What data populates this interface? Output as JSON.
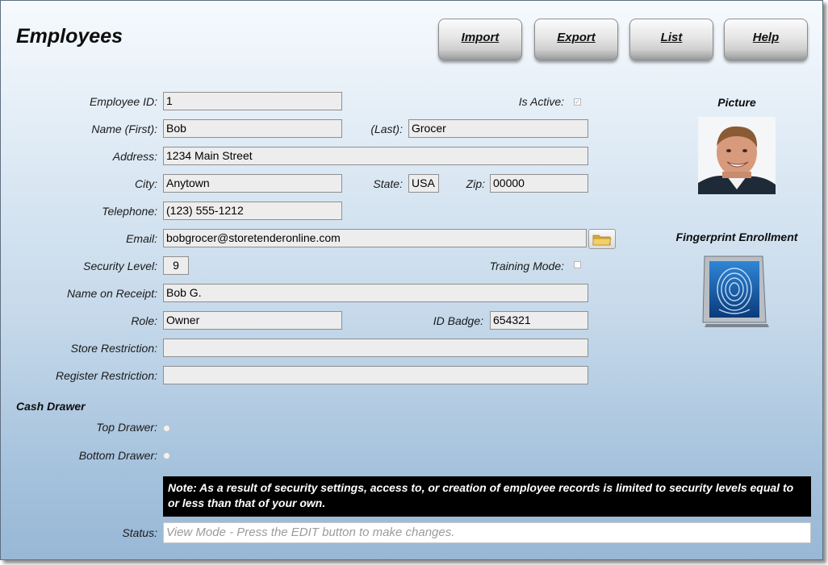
{
  "title": "Employees",
  "toolbar": {
    "import": "Import",
    "export": "Export",
    "list": "List",
    "help": "Help"
  },
  "form": {
    "employee_id": {
      "label": "Employee ID:",
      "value": "1"
    },
    "is_active": {
      "label": "Is Active:",
      "checked": true
    },
    "first_name": {
      "label": "Name (First):",
      "value": "Bob"
    },
    "last_name": {
      "label": "(Last):",
      "value": "Grocer"
    },
    "address": {
      "label": "Address:",
      "value": "1234 Main Street"
    },
    "city": {
      "label": "City:",
      "value": "Anytown"
    },
    "state": {
      "label": "State:",
      "value": "USA"
    },
    "zip": {
      "label": "Zip:",
      "value": "00000"
    },
    "telephone": {
      "label": "Telephone:",
      "value": "(123) 555-1212"
    },
    "email": {
      "label": "Email:",
      "value": "bobgrocer@storetenderonline.com"
    },
    "security_level": {
      "label": "Security Level:",
      "value": "9"
    },
    "training_mode": {
      "label": "Training Mode:",
      "checked": false
    },
    "name_on_receipt": {
      "label": "Name on Receipt:",
      "value": "Bob G."
    },
    "role": {
      "label": "Role:",
      "value": "Owner"
    },
    "id_badge": {
      "label": "ID Badge:",
      "value": "654321"
    },
    "store_restriction": {
      "label": "Store Restriction:",
      "value": ""
    },
    "register_restriction": {
      "label": "Register Restriction:",
      "value": ""
    }
  },
  "cash_drawer": {
    "heading": "Cash Drawer",
    "top_label": "Top Drawer:",
    "bottom_label": "Bottom Drawer:"
  },
  "picture": {
    "heading": "Picture"
  },
  "fingerprint": {
    "heading": "Fingerprint Enrollment"
  },
  "note": "Note: As a result of security settings, access to, or creation of employee records is limited to security levels equal to or less than that of your own.",
  "status": {
    "label": "Status:",
    "value": "View Mode - Press the EDIT button to make changes."
  },
  "icons": {
    "folder": "folder-icon",
    "fingerprint": "fingerprint-icon",
    "avatar": "employee-photo"
  }
}
